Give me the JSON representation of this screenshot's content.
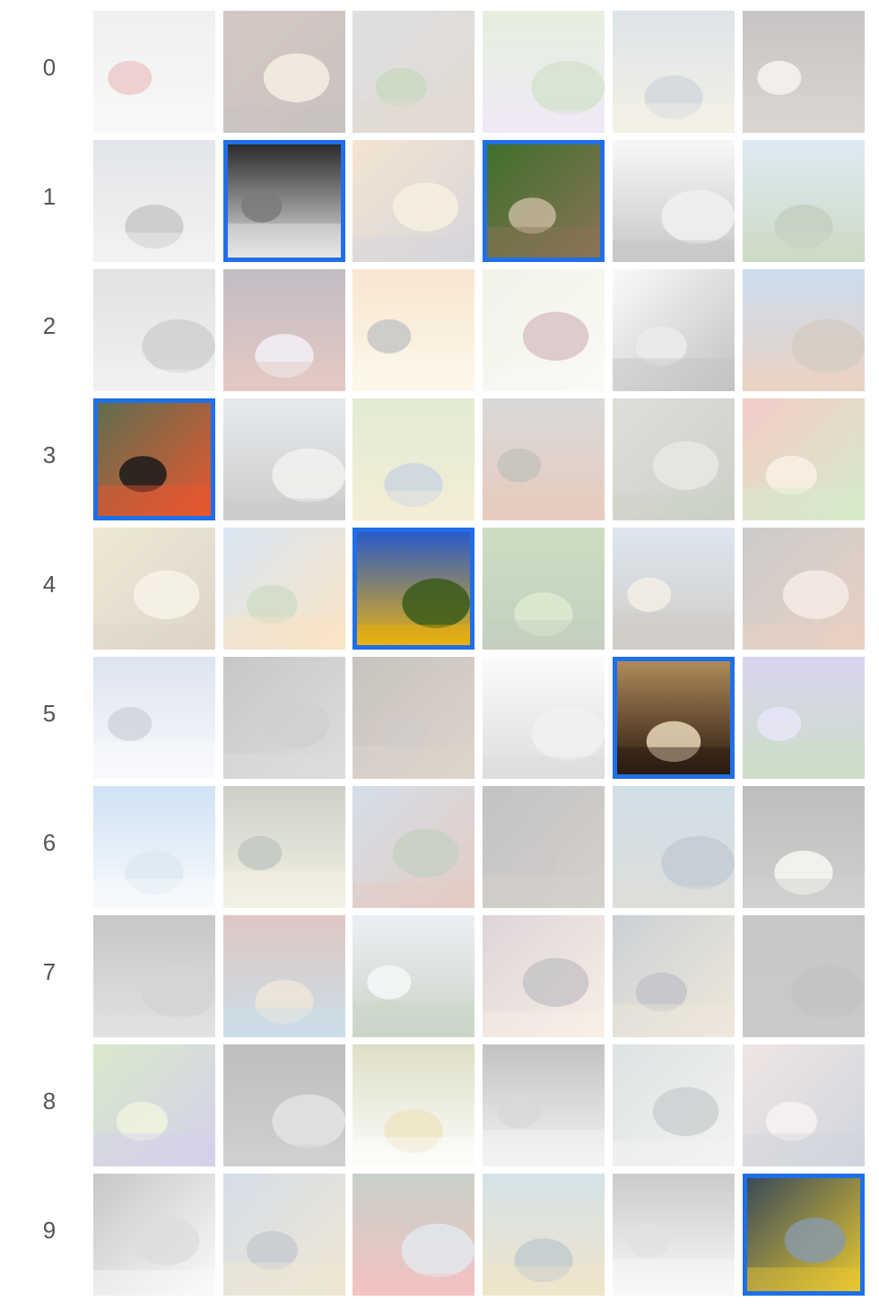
{
  "accent_color": "#1f6fe8",
  "rows": [
    {
      "label": "0",
      "tiles": [
        {
          "name": "misty-wire-photo",
          "selected": false,
          "colors": [
            "#c9ccce",
            "#e6e7e8",
            "#b44"
          ]
        },
        {
          "name": "red-light-trails-photo",
          "selected": false,
          "colors": [
            "#6b3b2b",
            "#3c2a22",
            "#e9c9a0"
          ]
        },
        {
          "name": "stone-hut-photo",
          "selected": false,
          "colors": [
            "#8a8f99",
            "#9b7c61",
            "#3d7a2a"
          ]
        },
        {
          "name": "purple-flower-photo",
          "selected": false,
          "colors": [
            "#a6c98b",
            "#c7b0e0",
            "#6f9a52"
          ]
        },
        {
          "name": "spider-web-photo",
          "selected": false,
          "colors": [
            "#8aa0b0",
            "#d9cfa8",
            "#5e7688"
          ]
        },
        {
          "name": "birthday-cake-photo",
          "selected": false,
          "colors": [
            "#3a3330",
            "#7a6a5c",
            "#e8dccd"
          ]
        }
      ]
    },
    {
      "label": "1",
      "tiles": [
        {
          "name": "woman-sky-photo",
          "selected": false,
          "colors": [
            "#9aa4b2",
            "#d6d2cf",
            "#3c3f45"
          ]
        },
        {
          "name": "dancing-couple-photo",
          "selected": true,
          "colors": [
            "#2b2b2b",
            "#e6e6e6",
            "#7a7a7a"
          ]
        },
        {
          "name": "sunset-lake-photo",
          "selected": false,
          "colors": [
            "#d9a35a",
            "#6f6c86",
            "#e8c98e"
          ]
        },
        {
          "name": "baby-owls-photo",
          "selected": true,
          "colors": [
            "#3f6f2a",
            "#8a7357",
            "#c6b79a"
          ]
        },
        {
          "name": "yoga-pose-photo",
          "selected": false,
          "colors": [
            "#e6e6e6",
            "#3a3a3a",
            "#cfcfcf"
          ]
        },
        {
          "name": "green-field-photo",
          "selected": false,
          "colors": [
            "#8db6d8",
            "#4f7f32",
            "#2e5a22"
          ]
        }
      ]
    },
    {
      "label": "2",
      "tiles": [
        {
          "name": "foggy-tree-photo",
          "selected": false,
          "colors": [
            "#9a9a9a",
            "#cfcfcf",
            "#5a5a5a"
          ]
        },
        {
          "name": "nebula-photo",
          "selected": false,
          "colors": [
            "#2a1530",
            "#a0402a",
            "#d6c9e8"
          ]
        },
        {
          "name": "orange-sun-photo",
          "selected": false,
          "colors": [
            "#e8a85a",
            "#f7e6b5",
            "#3a3a3a"
          ]
        },
        {
          "name": "white-orchids-photo",
          "selected": false,
          "colors": [
            "#c9d8a6",
            "#f2ece2",
            "#7a2b3a"
          ]
        },
        {
          "name": "railing-photo",
          "selected": false,
          "colors": [
            "#eeeeee",
            "#2a2a2a",
            "#bcbcbc"
          ]
        },
        {
          "name": "red-cliff-photo",
          "selected": false,
          "colors": [
            "#4a86c6",
            "#b4622f",
            "#6a4a2a"
          ]
        }
      ]
    },
    {
      "label": "3",
      "tiles": [
        {
          "name": "flamingo-photo",
          "selected": true,
          "colors": [
            "#5f6e4f",
            "#e8572f",
            "#1a1a1a"
          ]
        },
        {
          "name": "pier-photo",
          "selected": false,
          "colors": [
            "#a8b4c0",
            "#4a4a4a",
            "#d7d2c8"
          ]
        },
        {
          "name": "board-game-photo",
          "selected": false,
          "colors": [
            "#9ab86a",
            "#d8c46a",
            "#4a6a9a"
          ]
        },
        {
          "name": "cicada-photo",
          "selected": false,
          "colors": [
            "#7a7a7a",
            "#a84a1a",
            "#3a2a1a"
          ]
        },
        {
          "name": "vines-photo",
          "selected": false,
          "colors": [
            "#8a8f7a",
            "#4a5a3a",
            "#b0b29a"
          ]
        },
        {
          "name": "candy-photo",
          "selected": false,
          "colors": [
            "#d84a3a",
            "#6ab84a",
            "#f0d0a0"
          ]
        }
      ]
    },
    {
      "label": "4",
      "tiles": [
        {
          "name": "bear-tiger-photo",
          "selected": false,
          "colors": [
            "#c8b070",
            "#8a6a3a",
            "#e8d8b0"
          ]
        },
        {
          "name": "orange-poppies-photo",
          "selected": false,
          "colors": [
            "#7aa8d8",
            "#f0a030",
            "#5a8a3a"
          ]
        },
        {
          "name": "sunflowers-photo",
          "selected": true,
          "colors": [
            "#2a5ac8",
            "#e8b010",
            "#3a5a1a"
          ]
        },
        {
          "name": "green-trees-photo",
          "selected": false,
          "colors": [
            "#4a8a2a",
            "#2a5a1a",
            "#8ab85a"
          ]
        },
        {
          "name": "beach-frame-photo",
          "selected": false,
          "colors": [
            "#8aa8c8",
            "#5a4a3a",
            "#d8c8a8"
          ]
        },
        {
          "name": "red-hair-woman-photo",
          "selected": false,
          "colors": [
            "#4a4a4a",
            "#b05a2a",
            "#e0c0a8"
          ]
        }
      ]
    },
    {
      "label": "5",
      "tiles": [
        {
          "name": "snowy-river-photo",
          "selected": false,
          "colors": [
            "#8aa0c8",
            "#e8eef6",
            "#5a6a8a"
          ]
        },
        {
          "name": "old-house-photo",
          "selected": false,
          "colors": [
            "#3a3a3a",
            "#8a8a8a",
            "#5a5a5a"
          ]
        },
        {
          "name": "rock-wall-photo",
          "selected": false,
          "colors": [
            "#3a2a1a",
            "#8a6a4a",
            "#5a4a3a"
          ]
        },
        {
          "name": "feather-photo",
          "selected": false,
          "colors": [
            "#f2f2f2",
            "#8a8a8a",
            "#d0d0d0"
          ]
        },
        {
          "name": "brownie-camera-photo",
          "selected": true,
          "colors": [
            "#b08a5a",
            "#2a1a10",
            "#e8d8b8"
          ]
        },
        {
          "name": "purple-iris-photo",
          "selected": false,
          "colors": [
            "#7a6ac8",
            "#4a8a3a",
            "#b0a8e8"
          ]
        }
      ]
    },
    {
      "label": "6",
      "tiles": [
        {
          "name": "frozen-tower-photo",
          "selected": false,
          "colors": [
            "#5a9ad8",
            "#e8f0f8",
            "#8ab0d8"
          ]
        },
        {
          "name": "sunlit-woods-photo",
          "selected": false,
          "colors": [
            "#4a5a3a",
            "#d8d0a0",
            "#2a3a2a"
          ]
        },
        {
          "name": "red-building-photo",
          "selected": false,
          "colors": [
            "#6a8ab0",
            "#a04a2a",
            "#3a5a2a"
          ]
        },
        {
          "name": "dark-cave-photo",
          "selected": false,
          "colors": [
            "#2a2a2a",
            "#6a5a4a",
            "#4a4040"
          ]
        },
        {
          "name": "rocky-coast-photo",
          "selected": false,
          "colors": [
            "#5a8ab0",
            "#8a8a7a",
            "#2a4a6a"
          ]
        },
        {
          "name": "night-bus-stop-photo",
          "selected": false,
          "colors": [
            "#1a1a1a",
            "#5a5a5a",
            "#e8e8d8"
          ]
        }
      ]
    },
    {
      "label": "7",
      "tiles": [
        {
          "name": "viaduct-photo",
          "selected": false,
          "colors": [
            "#3a3a3a",
            "#9a9a9a",
            "#6a6a6a"
          ]
        },
        {
          "name": "tiles-floor-photo",
          "selected": false,
          "colors": [
            "#8a3a2a",
            "#4a8ab0",
            "#c8a880"
          ]
        },
        {
          "name": "misty-valley-photo",
          "selected": false,
          "colors": [
            "#b8c8d8",
            "#4a6a3a",
            "#e0e8f0"
          ]
        },
        {
          "name": "pebble-sunset-photo",
          "selected": false,
          "colors": [
            "#8a6a7a",
            "#e8c8a8",
            "#3a3040"
          ]
        },
        {
          "name": "puddle-reflection-photo",
          "selected": false,
          "colors": [
            "#4a5a6a",
            "#c8b080",
            "#2a3040"
          ]
        },
        {
          "name": "dark-blank-photo",
          "selected": false,
          "colors": [
            "#3a3a3a",
            "#444444",
            "#2e2e2e"
          ]
        }
      ]
    },
    {
      "label": "8",
      "tiles": [
        {
          "name": "bluebell-woods-photo",
          "selected": false,
          "colors": [
            "#7ab04a",
            "#6a5ab8",
            "#c8d890"
          ]
        },
        {
          "name": "car-interior-photo",
          "selected": false,
          "colors": [
            "#1a1a1a",
            "#5a5a5a",
            "#a0a0a0"
          ]
        },
        {
          "name": "daisy-photo",
          "selected": false,
          "colors": [
            "#8a8a3a",
            "#f8f8f0",
            "#c8a030"
          ]
        },
        {
          "name": "street-couple-photo",
          "selected": false,
          "colors": [
            "#2a2a2a",
            "#d8d8d8",
            "#7a7a7a"
          ]
        },
        {
          "name": "heron-water-photo",
          "selected": false,
          "colors": [
            "#8a9aa0",
            "#d8d8d0",
            "#4a5a60"
          ]
        },
        {
          "name": "harbor-city-photo",
          "selected": false,
          "colors": [
            "#c8a8a0",
            "#5a6a8a",
            "#e8d8d0"
          ]
        }
      ]
    },
    {
      "label": "9",
      "tiles": [
        {
          "name": "white-peacock-photo",
          "selected": false,
          "colors": [
            "#3a3a3a",
            "#f0f0f0",
            "#8a8a8a"
          ]
        },
        {
          "name": "beach-huts-photo",
          "selected": false,
          "colors": [
            "#6a8ab0",
            "#c8a860",
            "#3a4a5a"
          ]
        },
        {
          "name": "red-ferrari-photo",
          "selected": false,
          "colors": [
            "#3a5a3a",
            "#d82a2a",
            "#9ab0c0"
          ]
        },
        {
          "name": "glass-dome-photo",
          "selected": false,
          "colors": [
            "#6a9ab0",
            "#c8a040",
            "#2a4a5a"
          ]
        },
        {
          "name": "glasses-portrait-photo",
          "selected": false,
          "colors": [
            "#4a4a4a",
            "#e8e8e8",
            "#9a9a9a"
          ]
        },
        {
          "name": "city-street-aerial-photo",
          "selected": true,
          "colors": [
            "#3a4a5a",
            "#e8c830",
            "#8a9aa8"
          ]
        }
      ]
    }
  ]
}
